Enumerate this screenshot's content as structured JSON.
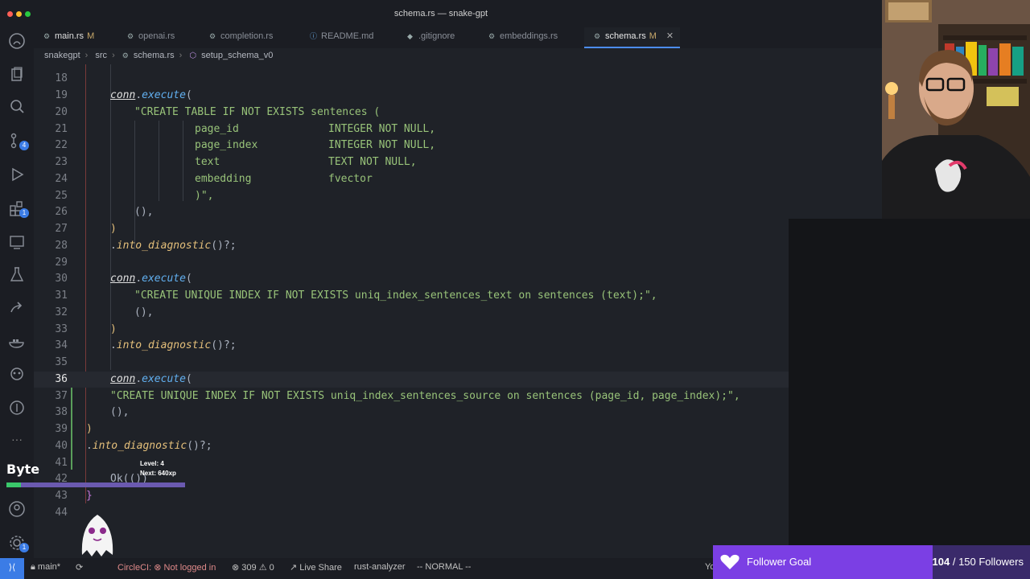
{
  "window": {
    "title": "schema.rs — snake-gpt"
  },
  "tabs": [
    {
      "label": "main.rs",
      "modified": "M",
      "active": false
    },
    {
      "label": "openai.rs",
      "active": false
    },
    {
      "label": "completion.rs",
      "active": false
    },
    {
      "label": "README.md",
      "active": false
    },
    {
      "label": ".gitignore",
      "active": false
    },
    {
      "label": "embeddings.rs",
      "active": false
    },
    {
      "label": "schema.rs",
      "modified": "M",
      "active": true
    }
  ],
  "breadcrumb": [
    "snakegpt",
    "src",
    "schema.rs",
    "setup_schema_v0"
  ],
  "activity": {
    "source_control_badge": "4",
    "extensions_badge": "1",
    "accounts_badge": "1"
  },
  "editor": {
    "current_line": "36",
    "lines": [
      {
        "n": "18",
        "text": ""
      },
      {
        "n": "19",
        "text": ""
      },
      {
        "n": "20",
        "text": ""
      },
      {
        "n": "21",
        "text": ""
      },
      {
        "n": "22",
        "text": ""
      },
      {
        "n": "23",
        "text": ""
      },
      {
        "n": "24",
        "text": ""
      },
      {
        "n": "25",
        "text": ""
      },
      {
        "n": "26",
        "text": ""
      },
      {
        "n": "27",
        "text": ""
      },
      {
        "n": "28",
        "text": ""
      },
      {
        "n": "29",
        "text": ""
      },
      {
        "n": "30",
        "text": ""
      },
      {
        "n": "31",
        "text": ""
      },
      {
        "n": "32",
        "text": ""
      },
      {
        "n": "33",
        "text": ""
      },
      {
        "n": "34",
        "text": ""
      },
      {
        "n": "35",
        "text": ""
      },
      {
        "n": "36",
        "text": ""
      },
      {
        "n": "37",
        "text": ""
      },
      {
        "n": "38",
        "text": ""
      },
      {
        "n": "39",
        "text": ""
      },
      {
        "n": "40",
        "text": ""
      },
      {
        "n": "41",
        "text": ""
      },
      {
        "n": "42",
        "text": ""
      },
      {
        "n": "43",
        "text": ""
      },
      {
        "n": "44",
        "text": ""
      }
    ],
    "code": {
      "conn": "conn",
      "execute": "execute",
      "into_diagnostic": "into_diagnostic",
      "create_table": "\"CREATE TABLE IF NOT EXISTS sentences (",
      "col_page_id": "page_id",
      "col_page_id_type": "INTEGER NOT NULL,",
      "col_page_index": "page_index",
      "col_page_index_type": "INTEGER NOT NULL,",
      "col_text": "text",
      "col_text_type": "TEXT NOT NULL,",
      "col_embedding": "embedding",
      "col_embedding_type": "fvector",
      "close_paren_str": ")\",",
      "unit": "(),",
      "close": ")",
      "diag_suffix": "()?;",
      "uniq_text": "\"CREATE UNIQUE INDEX IF NOT EXISTS uniq_index_sentences_text on sentences (text);\",",
      "uniq_source": "\"CREATE UNIQUE INDEX IF NOT EXISTS uniq_index_sentences_source on sentences (page_id, page_index);\",",
      "ok": "Ok(())",
      "brace": "}"
    }
  },
  "statusbar": {
    "branch": "main*",
    "circleci": "CircleCI:",
    "circleci_status": "Not logged in",
    "errors": "309",
    "warnings": "0",
    "live_share": "Live Share",
    "rust_analyzer": "rust-analyzer",
    "mode": "-- NORMAL --",
    "right": "Yo"
  },
  "overlay": {
    "byte_label": "Byte",
    "level": "Level: 4",
    "next": "Next: 640xp",
    "xp_progress": 0.08,
    "follower_label": "Follower Goal",
    "follower_current": "104",
    "follower_total": "/ 150 Followers",
    "follower_progress": 0.693
  },
  "colors": {
    "accent": "#3b7ce6",
    "follower": "#7b3fe4",
    "xp": "#3ac86b"
  }
}
